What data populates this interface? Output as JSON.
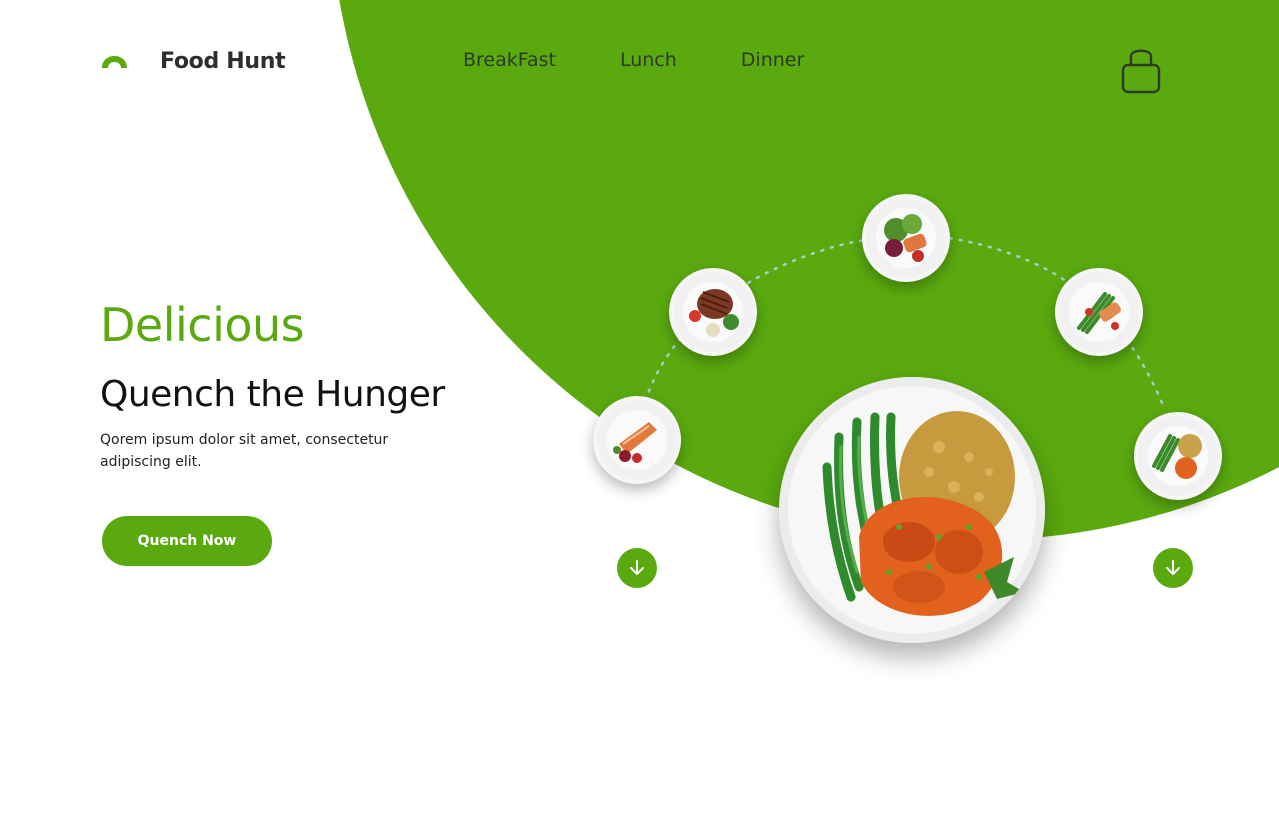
{
  "brand": {
    "name": "Food Hunt",
    "accent_color": "#5aaa0f",
    "logo_icon": "leaf-dome-icon"
  },
  "nav": {
    "items": [
      "BreakFast",
      "Lunch",
      "Dinner"
    ]
  },
  "header": {
    "cart_icon": "shopping-bag-icon"
  },
  "hero": {
    "tagline": "Delicious",
    "title": "Quench the Hunger",
    "description": "Qorem ipsum dolor sit amet, consectetur adipiscing elit.",
    "cta_label": "Quench Now"
  },
  "carousel": {
    "dishes": [
      {
        "name": "salmon-fillet-plate-icon"
      },
      {
        "name": "grilled-steak-plate-icon"
      },
      {
        "name": "salad-salmon-plate-icon"
      },
      {
        "name": "asparagus-salmon-plate-icon"
      },
      {
        "name": "beans-rice-chicken-plate-icon"
      }
    ],
    "featured": {
      "name": "green-beans-rice-chicken-plate-icon"
    },
    "prev_icon": "arrow-down-icon",
    "next_icon": "arrow-down-icon"
  }
}
